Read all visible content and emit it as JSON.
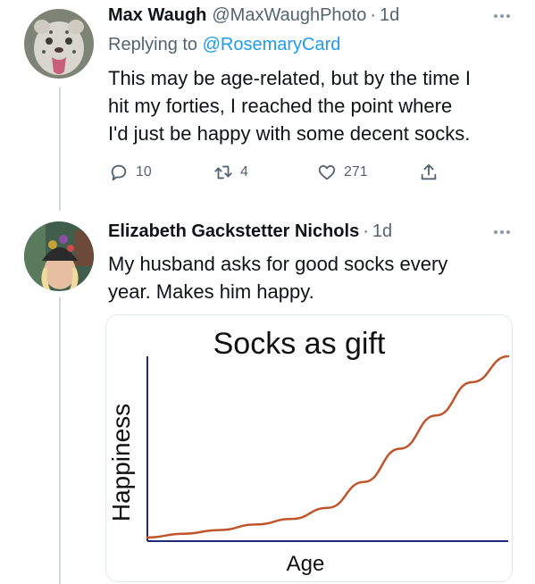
{
  "tweets": [
    {
      "name": "Max Waugh",
      "handle": "@MaxWaughPhoto",
      "separator": "·",
      "time": "1d",
      "replying_prefix": "Replying to",
      "replying_to": "@RosemaryCard",
      "text_lines": [
        "This may be age-related, but by the time I",
        "hit my forties, I reached the point where",
        "I'd just be happy with some decent socks."
      ],
      "actions": {
        "reply": {
          "icon": "comment-icon",
          "count": "10"
        },
        "retweet": {
          "icon": "retweet-icon",
          "count": "4"
        },
        "like": {
          "icon": "heart-icon",
          "count": "271"
        },
        "share": {
          "icon": "share-icon"
        }
      },
      "avatar": "snow-leopard-avatar"
    },
    {
      "name": "Elizabeth Gackstetter Nichols",
      "separator": "·",
      "time": "1d",
      "text_lines": [
        "My husband asks for good socks every",
        "year. Makes him happy."
      ],
      "avatar": "woman-with-hat-avatar"
    }
  ],
  "chart_data": {
    "type": "line",
    "title": "Socks as gift",
    "xlabel": "Age",
    "ylabel": "Happiness",
    "x": [
      0,
      10,
      20,
      30,
      40,
      50,
      60,
      70,
      80,
      90,
      100
    ],
    "y": [
      2,
      4,
      6,
      9,
      12,
      18,
      32,
      50,
      68,
      86,
      100
    ],
    "xlim": [
      0,
      100
    ],
    "ylim": [
      0,
      100
    ],
    "grid": false,
    "line_color": "#c0552c",
    "axis_color": "#1f2a78"
  },
  "colors": {
    "link": "#1d9bf0",
    "muted": "#536471",
    "text": "#0f1419",
    "thread_line": "#cfd9de"
  }
}
